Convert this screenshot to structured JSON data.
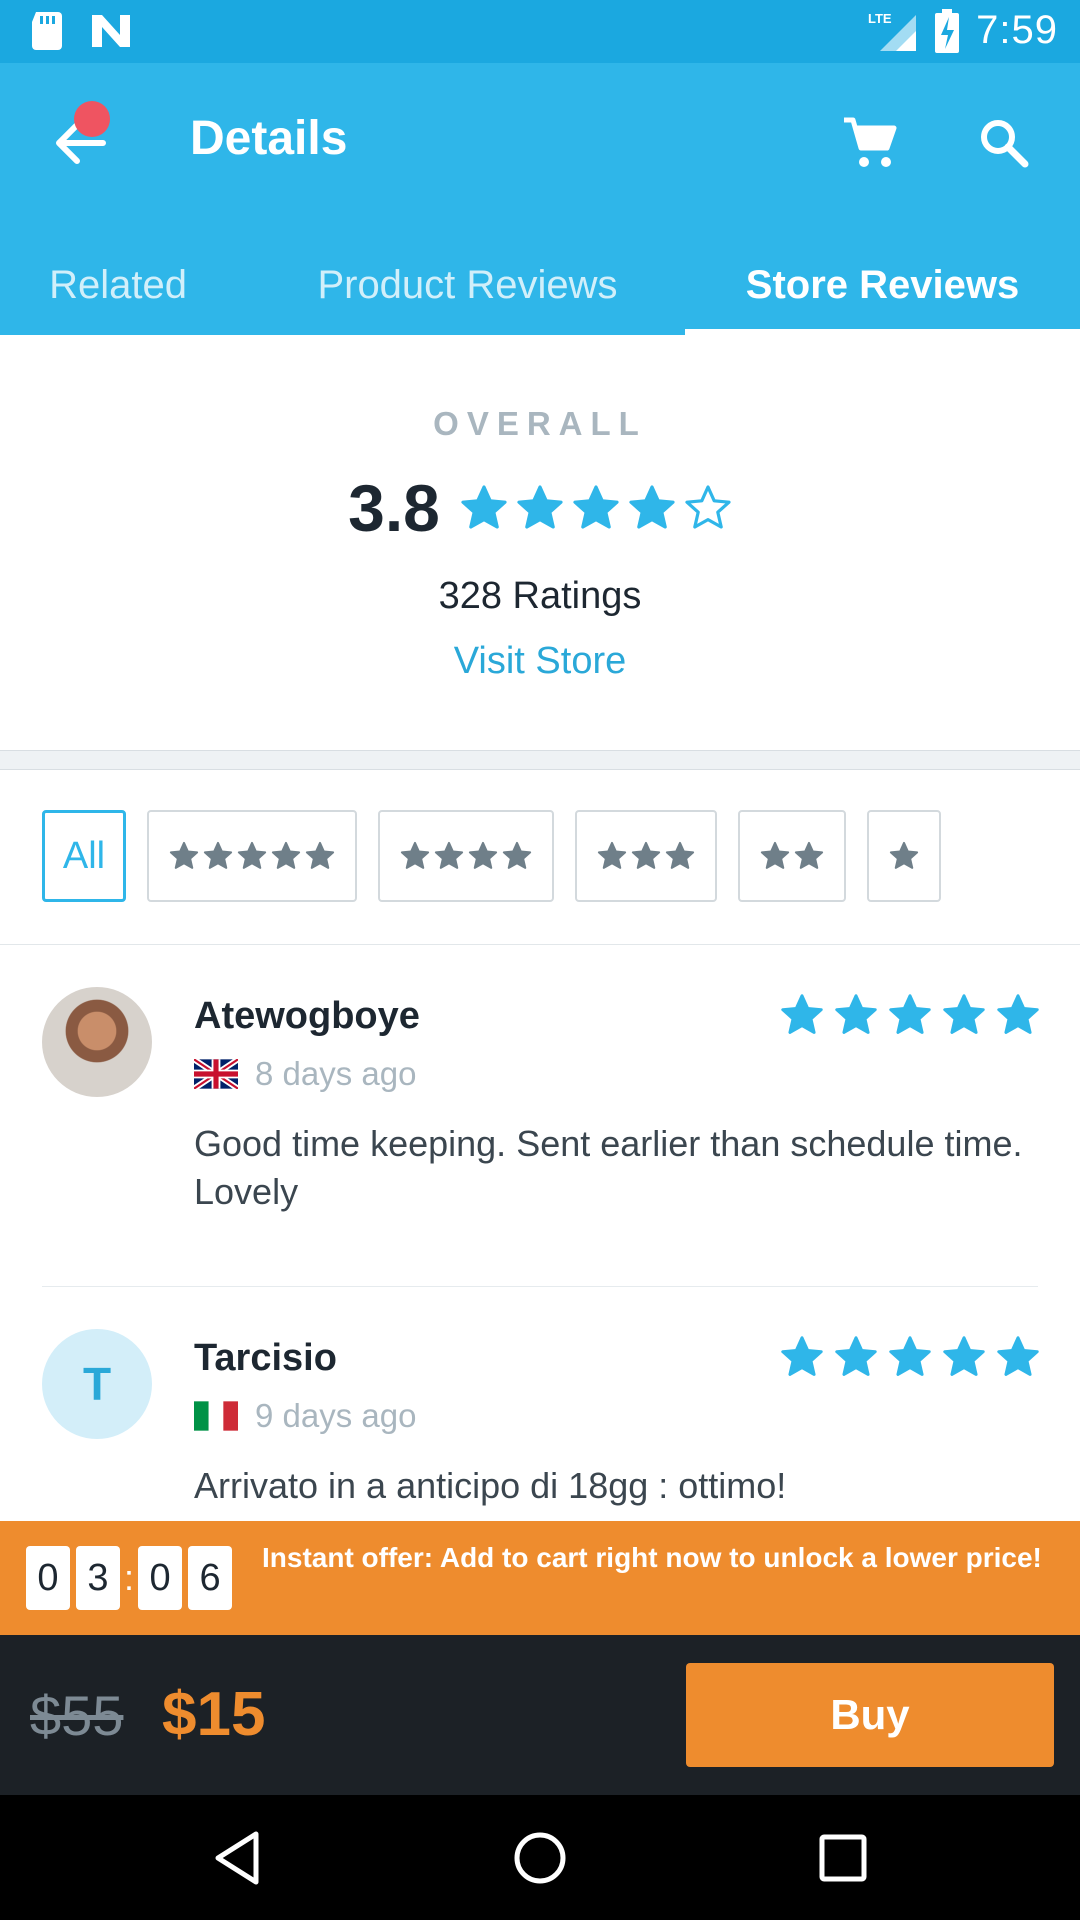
{
  "status_bar": {
    "time": "7:59",
    "network": "LTE"
  },
  "header": {
    "title": "Details"
  },
  "tabs": [
    {
      "label": "Related"
    },
    {
      "label": "Product Reviews"
    },
    {
      "label": "Store Reviews"
    }
  ],
  "active_tab": "Store Reviews",
  "overall": {
    "label": "OVERALL",
    "score": "3.8",
    "rating_value": 3.8,
    "ratings_count_text": "328 Ratings",
    "visit_store_label": "Visit Store"
  },
  "filters": [
    {
      "label": "All",
      "stars": 0
    },
    {
      "label": "",
      "stars": 5
    },
    {
      "label": "",
      "stars": 4
    },
    {
      "label": "",
      "stars": 3
    },
    {
      "label": "",
      "stars": 2
    },
    {
      "label": "",
      "stars": 1
    }
  ],
  "reviews": [
    {
      "name": "Atewogboye",
      "date": "8 days ago",
      "country_flag": "uk-flag",
      "stars": 5,
      "text": "Good time keeping. Sent earlier than schedule time. Lovely"
    },
    {
      "name": "Tarcisio",
      "avatar_letter": "T",
      "date": "9 days ago",
      "country_flag": "italy-flag",
      "stars": 5,
      "text": "Arrivato in a anticipo di 18gg : ottimo!"
    }
  ],
  "offer": {
    "timer": [
      "0",
      "3",
      "0",
      "6"
    ],
    "separator": ":",
    "text": "Instant offer: Add to cart right now to unlock a lower price!"
  },
  "purchase": {
    "old_price": "$55",
    "new_price": "$15",
    "buy_label": "Buy"
  },
  "colors": {
    "primary": "#2fb6e9",
    "status_bar": "#1ba8e0",
    "accent": "#ee8c2e",
    "star": "#2fb6e9",
    "dark_bar": "#1c2126"
  }
}
